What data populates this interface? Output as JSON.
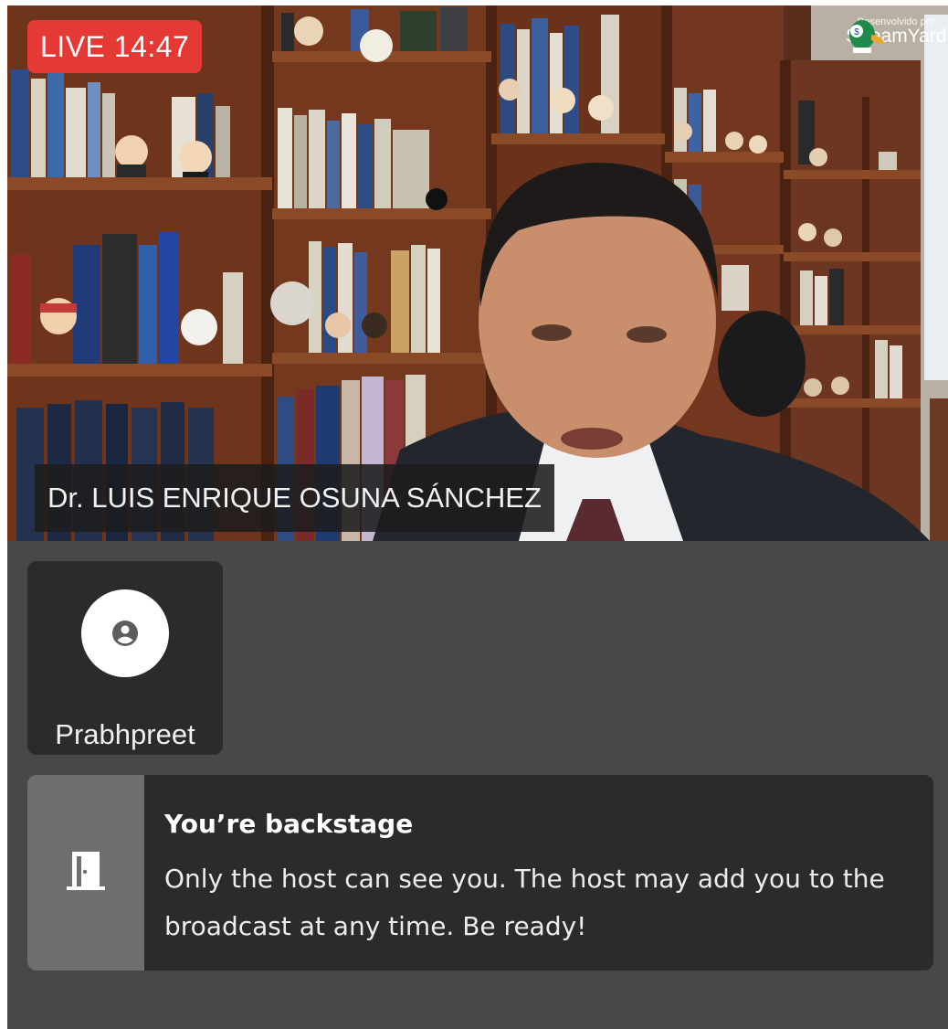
{
  "live": {
    "label": "LIVE 14:47"
  },
  "branding": {
    "caption": "Desenvolvido por",
    "name": "StreamYard"
  },
  "speaker": {
    "name": "Dr. LUIS ENRIQUE OSUNA SÁNCHEZ"
  },
  "participant": {
    "name": "Prabhpreet",
    "icon": "person-icon"
  },
  "backstage": {
    "icon": "door-icon",
    "title": "You’re backstage",
    "message": "Only the host can see you. The host may add you to the broadcast at any time. Be ready!"
  },
  "colors": {
    "live_badge": "#e53935",
    "panel_background": "#48484a",
    "tile_background": "#2b2b2d",
    "notice_side": "#6f6f71"
  }
}
